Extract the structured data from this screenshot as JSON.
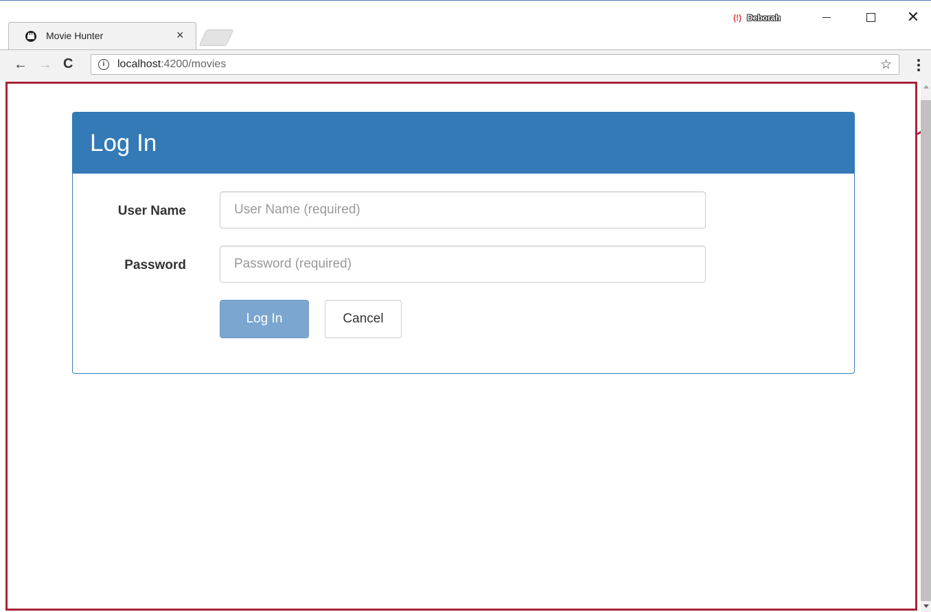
{
  "window": {
    "tab_title": "Movie Hunter",
    "tab_close": "×",
    "profile_badge": "(!)",
    "profile_name": "Deborah",
    "close_glyph": "✕"
  },
  "toolbar": {
    "url_host": "localhost",
    "url_rest": ":4200/movies",
    "info_glyph": "i",
    "star_glyph": "☆",
    "back_glyph": "←",
    "forward_glyph": "→",
    "reload_glyph": "C"
  },
  "login": {
    "title": "Log In",
    "username_label": "User Name",
    "username_placeholder": "User Name (required)",
    "username_value": "",
    "password_label": "Password",
    "password_placeholder": "Password (required)",
    "password_value": "",
    "login_button": "Log In",
    "cancel_button": "Cancel"
  },
  "colors": {
    "primary": "#337ab7",
    "primary_disabled": "#7ba6cf",
    "highlight_border": "#a82236",
    "profile_red": "#e03a3a"
  },
  "icons": [
    "film-favicon-icon",
    "close-icon",
    "profile-alert-icon",
    "minimize-icon",
    "maximize-icon",
    "close-window-icon",
    "back-arrow-icon",
    "forward-arrow-icon",
    "reload-icon",
    "info-icon",
    "star-icon",
    "kebab-menu-icon"
  ]
}
